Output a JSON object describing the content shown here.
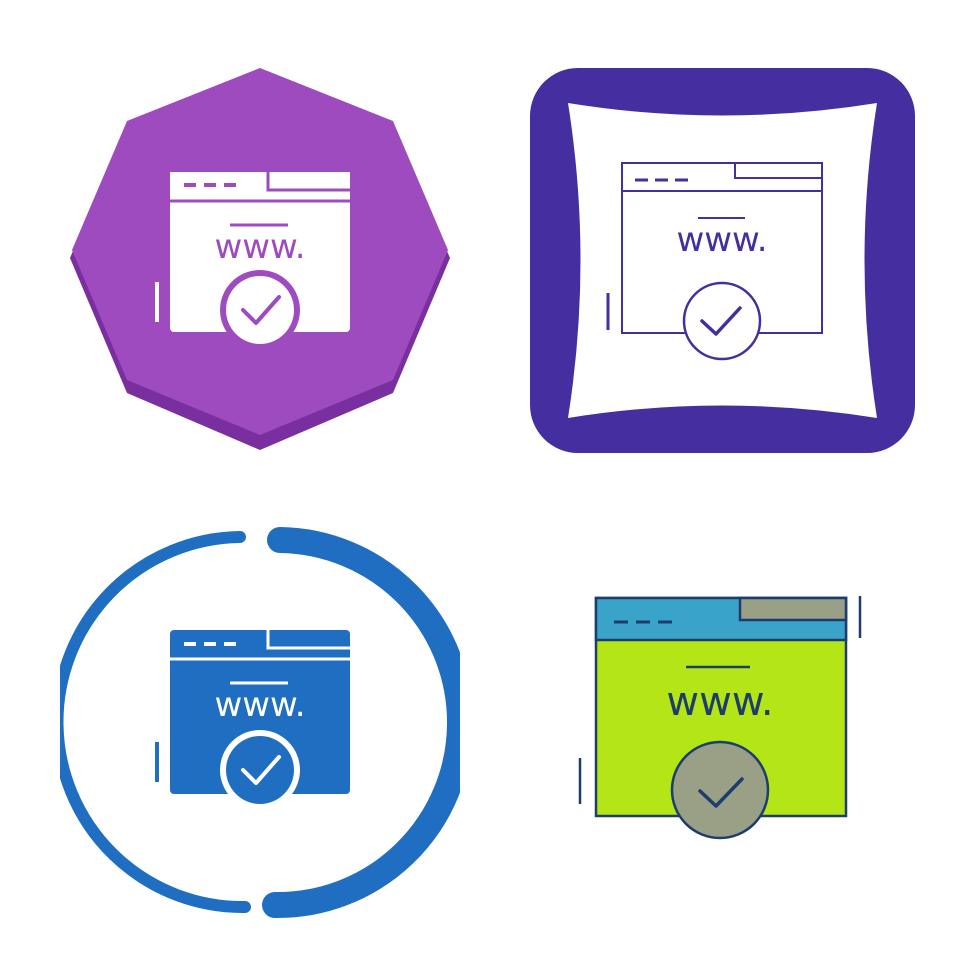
{
  "url_text": "www.",
  "colors": {
    "purple": "#9e4bbf",
    "purple_shadow": "#7a2fa0",
    "indigo": "#452e9f",
    "blue": "#1f6ec2",
    "teal": "#3aa3c9",
    "lime": "#b4e516",
    "gray": "#9aa086",
    "navy": "#1d3d6e",
    "white": "#ffffff"
  },
  "icons": [
    {
      "name": "web-verified-icon",
      "style": "purple-octagon-glyph"
    },
    {
      "name": "web-verified-icon",
      "style": "indigo-pillow-line"
    },
    {
      "name": "web-verified-icon",
      "style": "blue-circle-glyph"
    },
    {
      "name": "web-verified-icon",
      "style": "flat-color"
    }
  ]
}
